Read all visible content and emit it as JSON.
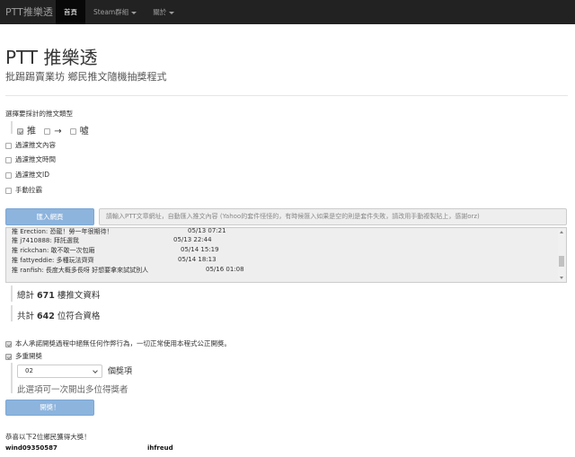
{
  "navbar": {
    "brand": "PTT推樂透",
    "items": [
      {
        "label": "首頁",
        "active": true
      },
      {
        "label": "Steam群組",
        "dropdown": true
      },
      {
        "label": "關於",
        "dropdown": true
      }
    ]
  },
  "header": {
    "title": "PTT 推樂透",
    "subtitle": "批踢踢賣業坊 鄉民推文隨機抽獎程式"
  },
  "push_type": {
    "heading": "選擇要採計的推文類型",
    "push_label": "推",
    "arrow_label": "→",
    "boo_label": "噓"
  },
  "options": {
    "filter_content": "過濾推文內容",
    "filter_time": "過濾推文時間",
    "filter_id": "過濾推文ID",
    "manual_paste": "手動拉霸"
  },
  "fetch": {
    "button_label": "匯入網頁",
    "url_placeholder": "請輸入PTT文章網址，自動匯入推文內容 (Yahoo的套件怪怪的，有時候匯入如果是空的則是套件失敗，請改用手動複製貼上，感謝orz)"
  },
  "push_lines": [
    {
      "text": "推 Erection: 恐龍！勞一年很期待！",
      "time": "05/13 07:21"
    },
    {
      "text": "推 j7410888: 拜託選我",
      "time": "05/13 22:44"
    },
    {
      "text": "推 rickchan: 敢不敢一次包廂",
      "time": "05/14 15:19"
    },
    {
      "text": "推 fattyeddie: 多種玩法齊齊",
      "time": "05/14 18:13"
    },
    {
      "text": "推 ranfish: 長度大概多長呀 好想要拿來試試別人",
      "time": "05/16 01:08"
    }
  ],
  "stats": {
    "total_prefix": "總計",
    "total_count": "671",
    "total_suffix": "樓推文資料",
    "eligible_prefix": "共計",
    "eligible_count": "642",
    "eligible_suffix": "位符合資格"
  },
  "agreement": {
    "commitment": "本人承諾開獎過程中絕無任何作弊行為，一切正常使用本程式公正開獎。",
    "multi_draw": "多重開獎"
  },
  "prize": {
    "selected": "02",
    "unit_label": "個獎項",
    "hint": "此選項可一次開出多位得獎者"
  },
  "draw": {
    "button_label": "開獎！",
    "result_heading": "恭喜以下2位鄉民獲得大獎！",
    "winners": [
      "wind09350587",
      "ihfreud"
    ]
  }
}
